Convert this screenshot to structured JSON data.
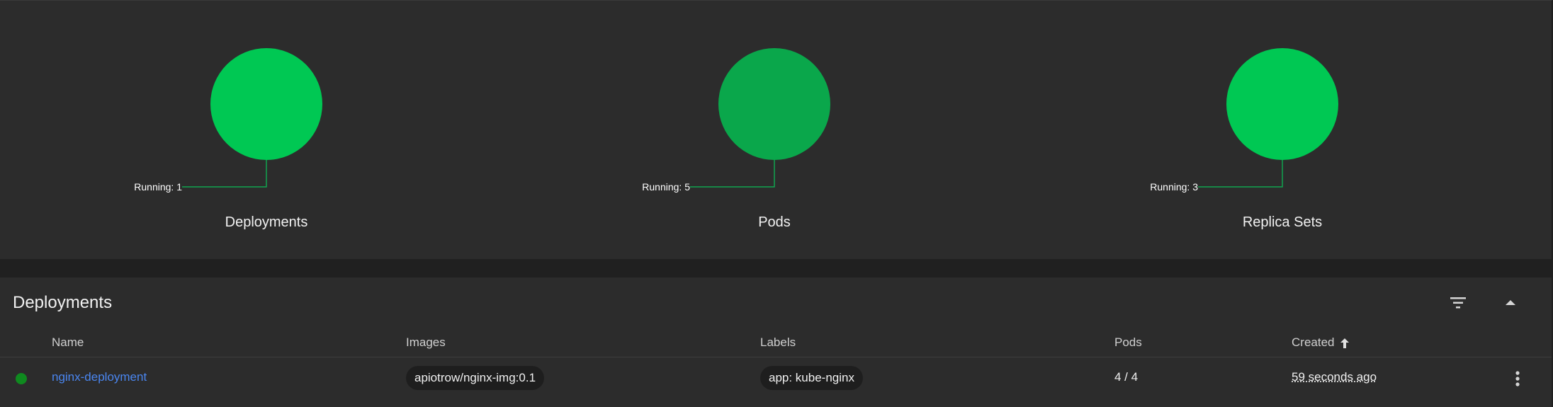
{
  "workload_status": {
    "charts": [
      {
        "title": "Deployments",
        "running_label": "Running: 1",
        "running": 1,
        "color": "#00c853"
      },
      {
        "title": "Pods",
        "running_label": "Running: 5",
        "running": 5,
        "color": "#0aa74b"
      },
      {
        "title": "Replica Sets",
        "running_label": "Running: 3",
        "running": 3,
        "color": "#00c853"
      }
    ],
    "leader_color": "#10a34e"
  },
  "deployments": {
    "title": "Deployments",
    "icons": {
      "filter": "filter-icon",
      "collapse": "chevron-up-icon",
      "more": "more-vert-icon",
      "sort": "arrow-up-icon"
    },
    "columns": {
      "name": "Name",
      "images": "Images",
      "labels": "Labels",
      "pods": "Pods",
      "created": "Created"
    },
    "sort": {
      "column": "Created",
      "direction": "ascending"
    },
    "rows": [
      {
        "status": "running",
        "status_color": "#0f8a1f",
        "name": "nginx-deployment",
        "image": "apiotrow/nginx-img:0.1",
        "label": "app: kube-nginx",
        "pods": "4 / 4",
        "created": "59 seconds ago"
      }
    ]
  }
}
